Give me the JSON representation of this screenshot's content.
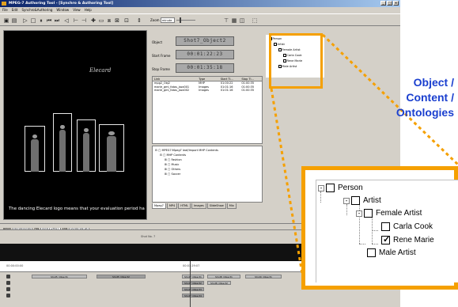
{
  "window": {
    "title": "MPEG-7 Authoring Tool - [Synchro & Authoring Tool]"
  },
  "menu": [
    "File",
    "Edit",
    "Synchro&Authoring",
    "Window",
    "View",
    "Help"
  ],
  "toolbar": {
    "zoom_label": "Zoom",
    "zoom_value": "minute"
  },
  "video": {
    "logo_text": "Elecard",
    "caption": "The dancing Elecard logo means that your evaluation period has"
  },
  "playback": {
    "begin_label": "Begin",
    "begin_value": "00:00:00:00",
    "pos_label": "Pos",
    "pos_value": "00:01:29:07",
    "end_label": "End",
    "end_value": "00:00:04:18"
  },
  "object_panel": {
    "object_label": "Object",
    "object_value": "Shot7_Object2",
    "start_label": "Start Frame",
    "start_value": "00:01:22:23",
    "stop_label": "Stop Frame",
    "stop_value": "00:01:35:18"
  },
  "link_table": {
    "columns": [
      "Link",
      "Type",
      "Start Ti...",
      "Stop Ti..."
    ],
    "rows": [
      [
        "mpg2_Obj2",
        "MHP",
        "01:00:22",
        "01:00:35"
      ],
      [
        "marie_gml_fotos_jazz001",
        "Images",
        "01:01:16",
        "01:00:35"
      ],
      [
        "marie_gml_fotos_jazz002",
        "Images",
        "01:01:16",
        "01:00:35"
      ]
    ]
  },
  "mpeg_tree": {
    "root": "MPEG7:Mpeg7 leaf/Import MHP Contents",
    "child": "MHP Contents",
    "items": [
      "Fashion",
      "Music",
      "Others",
      "Soccer"
    ]
  },
  "tabs": [
    "Mpeg7",
    "MP4",
    "HTML",
    "Images",
    "SlideShow",
    "Mix"
  ],
  "timeline": {
    "shots_label": "Shot No. 7",
    "marks": [
      "00:00:00:00",
      "00:01:29:07"
    ],
    "tracks": [
      [
        {
          "label": "Shot5_Object1",
          "dark": false
        },
        {
          "label": "Shot5_Object2",
          "dark": true
        },
        {
          "label": "Shot7_Object1",
          "dark": false
        },
        {
          "label": "Shot8_Object1",
          "dark": false
        },
        {
          "label": "Shot9_Object1",
          "dark": false
        }
      ],
      [
        {
          "label": "Shot7_Object2",
          "dark": true
        },
        {
          "label": "Shot8_Object2",
          "dark": false
        }
      ],
      [
        {
          "label": "Shot7_Object3",
          "dark": true
        }
      ],
      [
        {
          "label": "Shot7_Object4",
          "dark": true
        }
      ]
    ]
  },
  "callout": {
    "lines": [
      "Object /",
      "Content /",
      "Ontologies"
    ]
  },
  "ontology": {
    "person": "Person",
    "artist": "Artist",
    "female_artist": "Female Artist",
    "carla_cook": "Carla Cook",
    "rene_marie": "Rene Marie",
    "male_artist": "Male Artist",
    "checked": [
      "Rene Marie"
    ]
  },
  "colors": {
    "highlight": "#f5a000",
    "callout_text": "#1a3fcf"
  }
}
